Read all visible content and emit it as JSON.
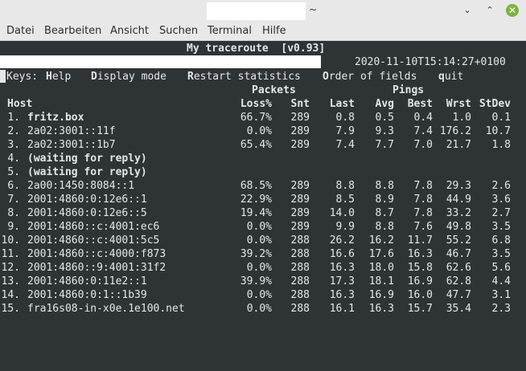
{
  "window": {
    "title_suffix": "~",
    "controls": {
      "minimize": "⌄",
      "maximize": "⌃",
      "close": "✕"
    }
  },
  "menu": [
    "Datei",
    "Bearbeiten",
    "Ansicht",
    "Suchen",
    "Terminal",
    "Hilfe"
  ],
  "mtr": {
    "title": "My traceroute  [v0.93]",
    "timestamp": "2020-11-10T15:14:27+0100",
    "keys_label": "Keys:",
    "keys": [
      {
        "hotkey": "H",
        "rest": "elp"
      },
      {
        "hotkey": "D",
        "rest": "isplay mode"
      },
      {
        "hotkey": "R",
        "rest": "estart statistics"
      },
      {
        "hotkey": "O",
        "rest": "rder of fields"
      },
      {
        "hotkey": "q",
        "rest": "uit"
      }
    ],
    "group_headers": {
      "packets": "Packets",
      "pings": "Pings"
    },
    "columns": [
      "Host",
      "Loss%",
      "Snt",
      "Last",
      "Avg",
      "Best",
      "Wrst",
      "StDev"
    ],
    "rows": [
      {
        "n": "1.",
        "host": "fritz.box",
        "bold": true,
        "loss": "66.7%",
        "snt": "289",
        "last": "0.8",
        "avg": "0.5",
        "best": "0.4",
        "wrst": "1.0",
        "stdev": "0.1"
      },
      {
        "n": "2.",
        "host": "2a02:3001::11f",
        "bold": false,
        "loss": "0.0%",
        "snt": "289",
        "last": "7.9",
        "avg": "9.3",
        "best": "7.4",
        "wrst": "176.2",
        "stdev": "10.7"
      },
      {
        "n": "3.",
        "host": "2a02:3001::1b7",
        "bold": false,
        "loss": "65.4%",
        "snt": "289",
        "last": "7.4",
        "avg": "7.7",
        "best": "7.0",
        "wrst": "21.7",
        "stdev": "1.8"
      },
      {
        "n": "4.",
        "host": "(waiting for reply)",
        "bold": true,
        "loss": "",
        "snt": "",
        "last": "",
        "avg": "",
        "best": "",
        "wrst": "",
        "stdev": ""
      },
      {
        "n": "5.",
        "host": "(waiting for reply)",
        "bold": true,
        "loss": "",
        "snt": "",
        "last": "",
        "avg": "",
        "best": "",
        "wrst": "",
        "stdev": ""
      },
      {
        "n": "6.",
        "host": "2a00:1450:8084::1",
        "bold": false,
        "loss": "68.5%",
        "snt": "289",
        "last": "8.8",
        "avg": "8.8",
        "best": "7.8",
        "wrst": "29.3",
        "stdev": "2.6"
      },
      {
        "n": "7.",
        "host": "2001:4860:0:12e6::1",
        "bold": false,
        "loss": "22.9%",
        "snt": "289",
        "last": "8.5",
        "avg": "8.9",
        "best": "7.8",
        "wrst": "44.9",
        "stdev": "3.6"
      },
      {
        "n": "8.",
        "host": "2001:4860:0:12e6::5",
        "bold": false,
        "loss": "19.4%",
        "snt": "289",
        "last": "14.0",
        "avg": "8.7",
        "best": "7.8",
        "wrst": "33.2",
        "stdev": "2.7"
      },
      {
        "n": "9.",
        "host": "2001:4860::c:4001:ec6",
        "bold": false,
        "loss": "0.0%",
        "snt": "289",
        "last": "9.9",
        "avg": "8.8",
        "best": "7.6",
        "wrst": "49.8",
        "stdev": "3.5"
      },
      {
        "n": "10.",
        "host": "2001:4860::c:4001:5c5",
        "bold": false,
        "loss": "0.0%",
        "snt": "288",
        "last": "26.2",
        "avg": "16.2",
        "best": "11.7",
        "wrst": "55.2",
        "stdev": "6.8"
      },
      {
        "n": "11.",
        "host": "2001:4860::c:4000:f873",
        "bold": false,
        "loss": "39.2%",
        "snt": "288",
        "last": "16.6",
        "avg": "17.6",
        "best": "16.3",
        "wrst": "46.7",
        "stdev": "3.5"
      },
      {
        "n": "12.",
        "host": "2001:4860::9:4001:31f2",
        "bold": false,
        "loss": "0.0%",
        "snt": "288",
        "last": "16.3",
        "avg": "18.0",
        "best": "15.8",
        "wrst": "62.6",
        "stdev": "5.6"
      },
      {
        "n": "13.",
        "host": "2001:4860:0:11e2::1",
        "bold": false,
        "loss": "39.9%",
        "snt": "288",
        "last": "17.3",
        "avg": "18.1",
        "best": "16.9",
        "wrst": "62.8",
        "stdev": "4.4"
      },
      {
        "n": "14.",
        "host": "2001:4860:0:1::1b39",
        "bold": false,
        "loss": "0.0%",
        "snt": "288",
        "last": "16.3",
        "avg": "16.9",
        "best": "16.0",
        "wrst": "47.7",
        "stdev": "3.1"
      },
      {
        "n": "15.",
        "host": "fra16s08-in-x0e.1e100.net",
        "bold": false,
        "loss": "0.0%",
        "snt": "288",
        "last": "16.1",
        "avg": "16.3",
        "best": "15.7",
        "wrst": "35.4",
        "stdev": "2.3"
      }
    ]
  }
}
